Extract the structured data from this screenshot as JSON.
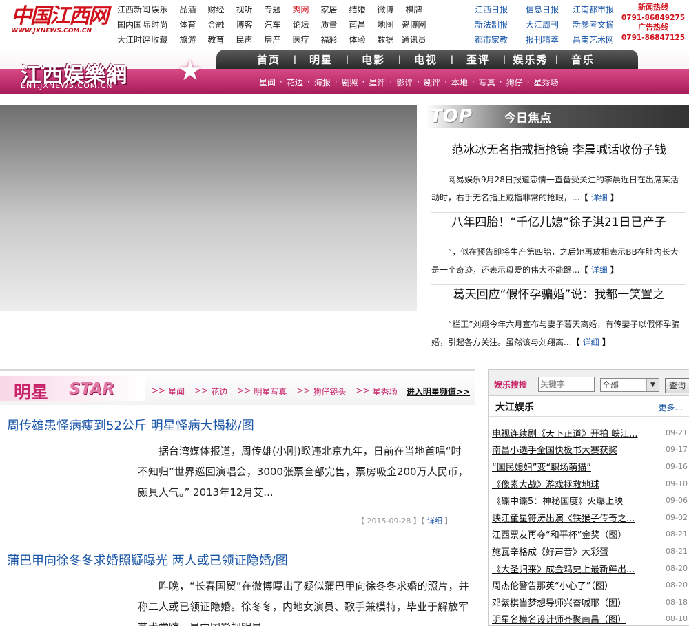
{
  "logo": {
    "cn": "中国江西网",
    "en": "WWW.JXNEWS.COM.CN"
  },
  "topnav": [
    [
      "江西新闻",
      "娱乐",
      "品酒",
      "财经",
      "视听",
      "专题",
      "爽网",
      "家居",
      "结婚",
      "微博",
      "棋牌"
    ],
    [
      "国内国际",
      "时尚",
      "体育",
      "金融",
      "博客",
      "汽车",
      "论坛",
      "质量",
      "南昌",
      "地图",
      "瓷博网"
    ],
    [
      "大江时评",
      "收藏",
      "旅游",
      "教育",
      "民声",
      "房产",
      "医疗",
      "福彩",
      "体验",
      "数据",
      "通讯员"
    ]
  ],
  "topnav2": [
    [
      "江西日报",
      "信息日报",
      "江南都市报"
    ],
    [
      "新法制报",
      "大江周刊",
      "新参考文摘"
    ],
    [
      "都市家教",
      "报刊精萃",
      "昌南艺术网"
    ]
  ],
  "hotline": {
    "news_label": "新闻热线",
    "news_num": "0791-86849275",
    "ad_label": "广告热线",
    "ad_num": "0791-86847125"
  },
  "banner": {
    "title": "江西娱樂網",
    "sub": "ENT.JXNEWS.COM.CN"
  },
  "mainnav": [
    "首页",
    "明星",
    "电影",
    "电视",
    "歪评",
    "娱乐秀",
    "音乐"
  ],
  "subnav": [
    "星闻",
    "花边",
    "海报",
    "剧照",
    "星评",
    "影评",
    "剧评",
    "本地",
    "写真",
    "狗仔",
    "星秀场"
  ],
  "focus": {
    "top_label": "TOP",
    "today_label": "今日焦点",
    "more_label": "详细",
    "stories": [
      {
        "title": "范冰冰无名指戒指抢镜 李晨喊话收份子钱",
        "summary": "网易娱乐9月28日报道恋情一直备受关注的李晨近日在出席某活动时，右手无名指上戒指非常的抢眼，..."
      },
      {
        "title": "八年四胎！“千亿儿媳”徐子淇21日已产子",
        "summary": "”，似在预告即将生产第四胎，之后她再放相表示BB在肚内长大是一个奇迹，还表示母爱的伟大不能跟..."
      },
      {
        "title": "葛天回应“假怀孕骗婚”说：我都一笑置之",
        "summary": "“栏王”刘翔今年六月宣布与妻子葛天离婚，有传妻子以假怀孕骗婚，引起各方关注。虽然该与刘翔离..."
      }
    ]
  },
  "star": {
    "title_cn": "明星",
    "title_en": "STAR",
    "links": [
      "星闻",
      "花边",
      "明星写真",
      "狗仔镜头",
      "星秀场"
    ],
    "enter": "进入明星频道>>",
    "articles": [
      {
        "title": "周传雄患怪病瘦到52公斤 明星怪病大揭秘/图",
        "summary": "据台湾媒体报道，周传雄(小刚)睽违北京九年，日前在当地首唱“时不知归”世界巡回演唱会，3000张票全部完售，票房吸金200万人民币，颇具人气。” 2013年12月艾...",
        "date": "2015-09-28",
        "more": "详细"
      },
      {
        "title": "蒲巴甲向徐冬冬求婚照疑曝光 两人或已领证隐婚/图",
        "summary": "昨晚，“长春国贸”在微博曝出了疑似蒲巴甲向徐冬冬求婚的照片，并称二人或已领证隐婚。徐冬冬，内地女演员、歌手兼模特，毕业于解放军艺术学院，是中国影视明星。"
      }
    ]
  },
  "search": {
    "label": "娱乐搜搜",
    "placeholder": "关键字",
    "select": "全部",
    "button": "查询"
  },
  "dajiang": {
    "title": "大江娱乐",
    "more": "更多...",
    "items": [
      {
        "t": "电视连续剧《天下正道》开拍 峡江...",
        "d": "09-21"
      },
      {
        "t": "南昌小选手全国快板书大赛获奖",
        "d": "09-17"
      },
      {
        "t": "“国民媳妇”变“职场萌猫”",
        "d": "09-16"
      },
      {
        "t": "《像素大战》游戏拯救地球",
        "d": "09-10"
      },
      {
        "t": "《碟中谍5：神秘国度》火爆上映",
        "d": "09-06"
      },
      {
        "t": "峡江童星符涛出演《铁猴子传奇之...",
        "d": "09-02"
      },
      {
        "t": "江西票友再夺“和平杯”金奖（图）",
        "d": "08-21"
      },
      {
        "t": "施瓦辛格成《好声音》大彩蛋",
        "d": "08-21"
      },
      {
        "t": "《大圣归来》成金鸡史上最新鲜出...",
        "d": "08-20"
      },
      {
        "t": "周杰伦警告那英“小心了”（图）",
        "d": "08-20"
      },
      {
        "t": "邓紫棋当梦想导师兴奋喊耶（图）",
        "d": "08-18"
      },
      {
        "t": "明星名模名设计师齐聚南昌（图）",
        "d": "08-18"
      }
    ]
  }
}
